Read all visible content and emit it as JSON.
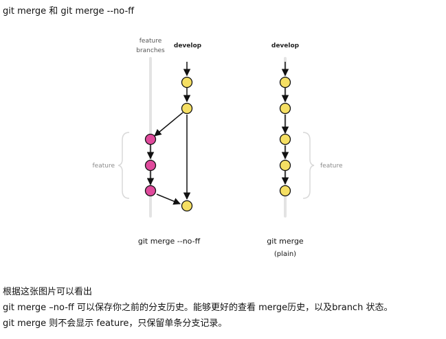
{
  "heading": "git merge 和 git merge --no-ff",
  "figure": {
    "left_diagram": {
      "feature_branches_label_line1": "feature",
      "feature_branches_label_line2": "branches",
      "develop_label": "develop",
      "feature_brace_label": "feature",
      "caption": "git merge --no-ff"
    },
    "right_diagram": {
      "develop_label": "develop",
      "feature_brace_label": "feature",
      "caption": "git merge",
      "caption_sub": "(plain)"
    },
    "colors": {
      "commit_yellow": "#f5df63",
      "commit_pink": "#e04a9c",
      "branch_line": "#e3e3e3",
      "arrow": "#111111",
      "label_grey": "#8a8a8a"
    }
  },
  "paragraphs": [
    "根据这张图片可以看出",
    "git merge –no-ff 可以保存你之前的分支历史。能够更好的查看 merge历史，以及branch 状态。",
    "git merge 则不会显示 feature，只保留单条分支记录。"
  ]
}
